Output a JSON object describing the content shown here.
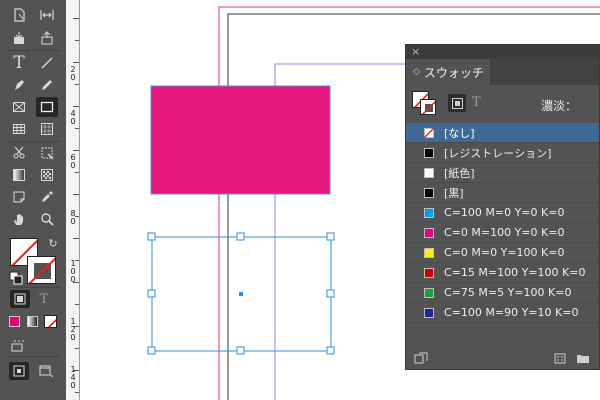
{
  "panel": {
    "title": "スウォッチ",
    "tint_label": "濃淡：",
    "swatches": [
      {
        "label": "[なし]",
        "color": "none",
        "selected": true
      },
      {
        "label": "[レジストレーション]",
        "color": "#000000",
        "selected": false
      },
      {
        "label": "[紙色]",
        "color": "#ffffff",
        "selected": false
      },
      {
        "label": "[黒]",
        "color": "#000000",
        "selected": false
      },
      {
        "label": "C=100 M=0 Y=0 K=0",
        "color": "#00a0e9",
        "selected": false
      },
      {
        "label": "C=0 M=100 Y=0 K=0",
        "color": "#e4007f",
        "selected": false
      },
      {
        "label": "C=0 M=0 Y=100 K=0",
        "color": "#fff100",
        "selected": false
      },
      {
        "label": "C=15 M=100 Y=100 K=0",
        "color": "#c7000b",
        "selected": false
      },
      {
        "label": "C=75 M=5 Y=100 K=0",
        "color": "#1ba035",
        "selected": false
      },
      {
        "label": "C=100 M=90 Y=10 K=0",
        "color": "#1d2c88",
        "selected": false
      }
    ]
  },
  "ruler": {
    "labels": [
      "2 0",
      "4 0",
      "6 0",
      "8 0",
      "1 0 0",
      "1 2 0",
      "1 4 0"
    ]
  },
  "colors": {
    "magenta_fill": "#e4187d",
    "selection": "#2b8fe0",
    "margin_guide": "#e4317f",
    "column_guide": "#9c7ff0",
    "toolbar_bg": "#535353",
    "panel_bg": "#535353"
  },
  "tools": {
    "text_tool_glyph": "T",
    "formatting_text_glyph": "T"
  }
}
